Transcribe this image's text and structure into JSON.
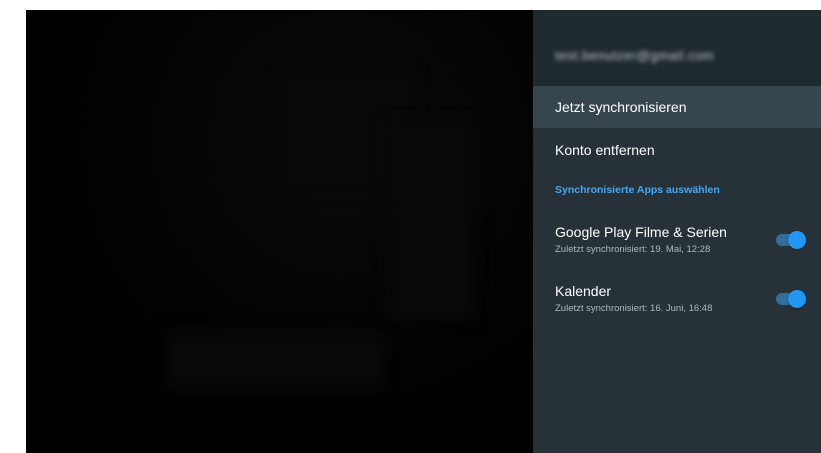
{
  "account": {
    "email": "test.benutzer@gmail.com"
  },
  "menu": {
    "sync_now_label": "Jetzt synchronisieren",
    "remove_account_label": "Konto entfernen"
  },
  "section": {
    "header": "Synchronisierte Apps auswählen"
  },
  "apps": [
    {
      "title": "Google Play Filme & Serien",
      "subtitle": "Zuletzt synchronisiert: 19. Mai, 12:28",
      "enabled": true
    },
    {
      "title": "Kalender",
      "subtitle": "Zuletzt synchronisiert: 16. Juni, 16:48",
      "enabled": true
    }
  ],
  "colors": {
    "panel_bg": "#263238",
    "focus_bg": "#37464c",
    "accent": "#4ca6f0",
    "toggle_on": "#2196f3"
  }
}
